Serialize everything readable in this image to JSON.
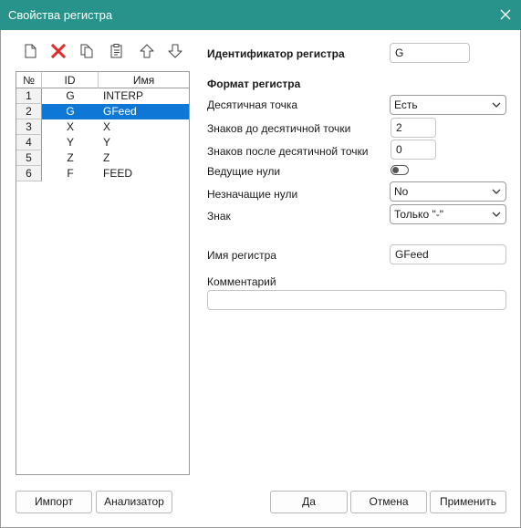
{
  "window": {
    "title": "Свойства регистра"
  },
  "toolbar": {
    "icons": [
      "new-icon",
      "delete-icon",
      "copy-icon",
      "paste-icon",
      "arrow-up-icon",
      "arrow-down-icon"
    ],
    "delete_color": "#e02b2b"
  },
  "table": {
    "columns": {
      "num": "№",
      "id": "ID",
      "name": "Имя"
    },
    "rows": [
      {
        "num": "1",
        "id": "G",
        "name": "INTERP"
      },
      {
        "num": "2",
        "id": "G",
        "name": "GFeed"
      },
      {
        "num": "3",
        "id": "X",
        "name": "X"
      },
      {
        "num": "4",
        "id": "Y",
        "name": "Y"
      },
      {
        "num": "5",
        "id": "Z",
        "name": "Z"
      },
      {
        "num": "6",
        "id": "F",
        "name": "FEED"
      }
    ],
    "selected_row": 2,
    "selection_color": "#0f78d7"
  },
  "form": {
    "identifier_label": "Идентификатор регистра",
    "identifier_value": "G",
    "format_heading": "Формат регистра",
    "decimal_point_label": "Десятичная точка",
    "decimal_point_value": "Есть",
    "digits_before_label": "Знаков до десятичной точки",
    "digits_before_value": "2",
    "digits_after_label": "Знаков после десятичной точки",
    "digits_after_value": "0",
    "leading_zeros_label": "Ведущие нули",
    "leading_zeros_on": false,
    "trailing_zeros_label": "Незначащие нули",
    "trailing_zeros_value": "No",
    "sign_label": "Знак",
    "sign_value": "Только \"-\"",
    "register_name_label": "Имя регистра",
    "register_name_value": "GFeed",
    "comment_label": "Комментарий",
    "comment_value": ""
  },
  "buttons": {
    "import": "Импорт",
    "analyzer": "Анализатор",
    "ok": "Да",
    "cancel": "Отмена",
    "apply": "Применить"
  },
  "colors": {
    "titlebar": "#27938a"
  }
}
